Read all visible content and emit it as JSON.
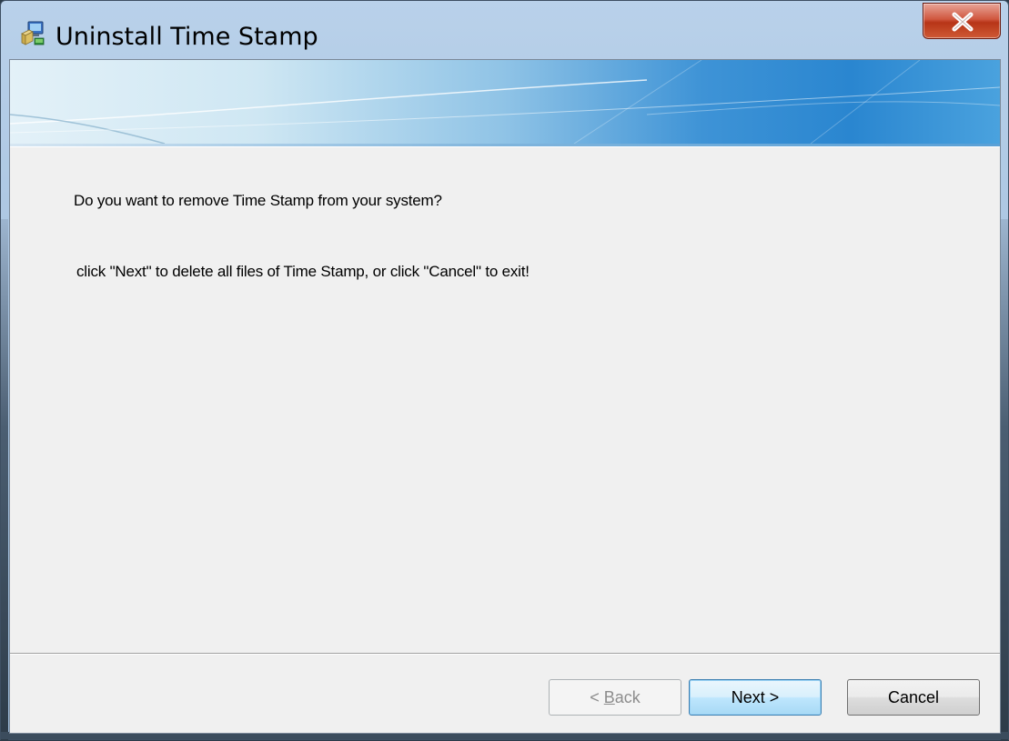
{
  "window": {
    "title": "Uninstall Time Stamp"
  },
  "titlebar": {
    "icon": "installer-icon",
    "close_icon": "close-x-icon",
    "close_color": "#c7452a"
  },
  "content": {
    "question": "Do you want to remove Time Stamp from your system?",
    "instruction": "click \"Next\" to delete all files of Time Stamp, or click \"Cancel\" to exit!"
  },
  "buttons": {
    "back_prefix": "< ",
    "back_accel": "B",
    "back_rest": "ack",
    "next_label": "Next >",
    "cancel_label": "Cancel"
  },
  "colors": {
    "dialog_background": "#f0f0f0",
    "banner_accent": "#2a86d0",
    "disabled_text": "#8d8d8d"
  }
}
